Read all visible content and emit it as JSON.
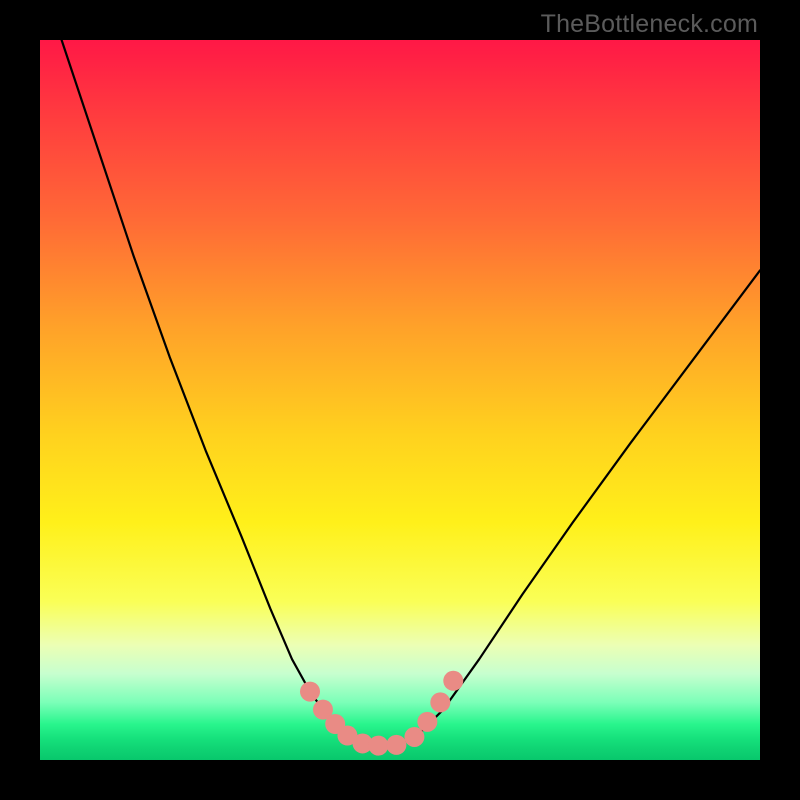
{
  "watermark": "TheBottleneck.com",
  "chart_data": {
    "type": "line",
    "title": "",
    "xlabel": "",
    "ylabel": "",
    "xlim": [
      0,
      100
    ],
    "ylim": [
      0,
      100
    ],
    "series": [
      {
        "name": "left-curve",
        "x": [
          3,
          8,
          13,
          18,
          23,
          28,
          32,
          35,
          37.5,
          40,
          42.5
        ],
        "y": [
          100,
          85,
          70,
          56,
          43,
          31,
          21,
          14,
          9.5,
          6,
          3.5
        ]
      },
      {
        "name": "valley-floor",
        "x": [
          42.5,
          45,
          47.5,
          50,
          52.5
        ],
        "y": [
          3.5,
          2.2,
          2,
          2.2,
          3.5
        ]
      },
      {
        "name": "right-curve",
        "x": [
          52.5,
          56,
          61,
          67,
          74,
          82,
          91,
          100
        ],
        "y": [
          3.5,
          7,
          14,
          23,
          33,
          44,
          56,
          68
        ]
      }
    ],
    "markers": {
      "name": "salmon-dots",
      "color": "#e98b85",
      "points": [
        {
          "x": 37.5,
          "y": 9.5
        },
        {
          "x": 39.3,
          "y": 7.0
        },
        {
          "x": 41.0,
          "y": 5.0
        },
        {
          "x": 42.7,
          "y": 3.4
        },
        {
          "x": 44.8,
          "y": 2.3
        },
        {
          "x": 47.0,
          "y": 2.0
        },
        {
          "x": 49.5,
          "y": 2.1
        },
        {
          "x": 52.0,
          "y": 3.2
        },
        {
          "x": 53.8,
          "y": 5.3
        },
        {
          "x": 55.6,
          "y": 8.0
        },
        {
          "x": 57.4,
          "y": 11.0
        }
      ]
    },
    "annotations": []
  }
}
